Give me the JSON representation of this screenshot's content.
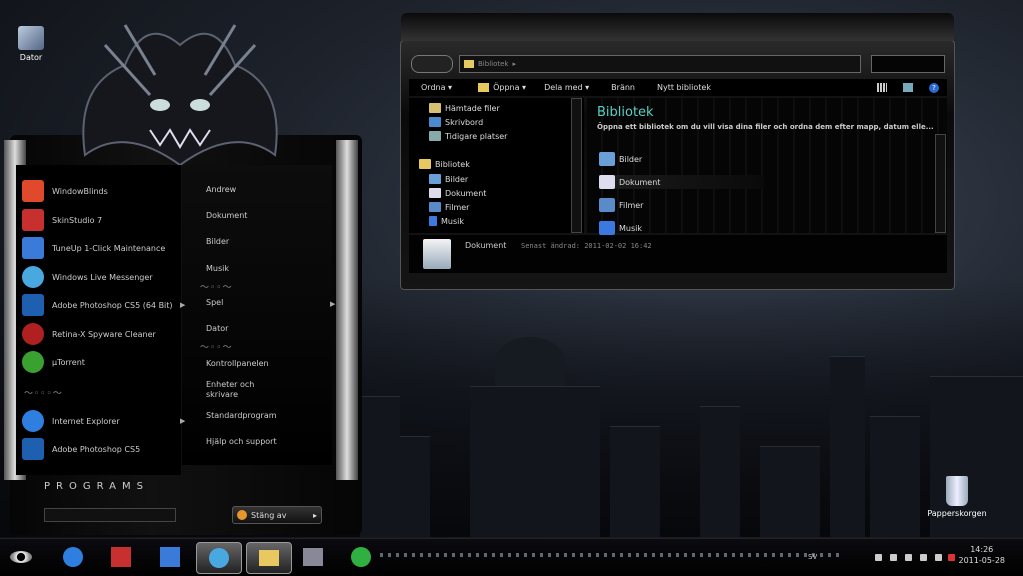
{
  "desktop": {
    "icons": [
      {
        "label": "Dator"
      },
      {
        "label": "Papperskorgen"
      }
    ]
  },
  "start_menu": {
    "programs": [
      {
        "label": "WindowBlinds",
        "icon": "windowblinds-icon",
        "color": "#e04a2a"
      },
      {
        "label": "SkinStudio 7",
        "icon": "skinstudio-icon",
        "color": "#c83030"
      },
      {
        "label": "TuneUp 1-Click Maintenance",
        "icon": "tuneup-icon",
        "color": "#3a7ad8"
      },
      {
        "label": "Windows Live Messenger",
        "icon": "messenger-icon",
        "color": "#4aa8e0"
      },
      {
        "label": "Adobe Photoshop CS5 (64 Bit)",
        "icon": "photoshop-icon",
        "color": "#1e5fb0"
      },
      {
        "label": "Retina-X Spyware Cleaner",
        "icon": "spyware-cleaner-icon",
        "color": "#b02020"
      },
      {
        "label": "µTorrent",
        "icon": "utorrent-icon",
        "color": "#3aa030"
      },
      {
        "label": "Internet Explorer",
        "icon": "internet-explorer-icon",
        "color": "#2f7fe0"
      },
      {
        "label": "Adobe Photoshop CS5",
        "icon": "photoshop-icon",
        "color": "#1e5fb0"
      }
    ],
    "places": [
      {
        "label": "Andrew"
      },
      {
        "label": "Dokument"
      },
      {
        "label": "Bilder"
      },
      {
        "label": "Musik"
      },
      {
        "label": "Spel"
      },
      {
        "label": "Dator"
      },
      {
        "label": "Kontrollpanelen"
      },
      {
        "label": "Enheter och skrivare"
      },
      {
        "label": "Standardprogram"
      },
      {
        "label": "Hjälp och support"
      }
    ],
    "programs_label": "PROGRAMS",
    "shutdown_label": "Stäng av"
  },
  "explorer": {
    "address": "Bibliotek",
    "toolbar": {
      "ordna": "Ordna",
      "oppna": "Öppna",
      "dela_med": "Dela med",
      "branna": "Bränn",
      "nytt_bibliotek": "Nytt bibliotek"
    },
    "nav": {
      "favorites": [
        {
          "label": "Hämtade filer"
        },
        {
          "label": "Skrivbord"
        },
        {
          "label": "Tidigare platser"
        }
      ],
      "library_root": "Bibliotek",
      "libraries": [
        {
          "label": "Bilder"
        },
        {
          "label": "Dokument"
        },
        {
          "label": "Filmer"
        },
        {
          "label": "Musik"
        }
      ]
    },
    "content": {
      "title": "Bibliotek",
      "description": "Öppna ett bibliotek om du vill visa dina filer och ordna dem efter mapp, datum elle...",
      "items": [
        {
          "label": "Bilder"
        },
        {
          "label": "Dokument"
        },
        {
          "label": "Filmer"
        },
        {
          "label": "Musik"
        }
      ]
    },
    "details": {
      "name": "Dokument",
      "modified": "Senast ändrad: 2011-02-02 16:42"
    }
  },
  "taskbar": {
    "language": "SV",
    "time": "14:26",
    "date": "2011-05-28"
  }
}
